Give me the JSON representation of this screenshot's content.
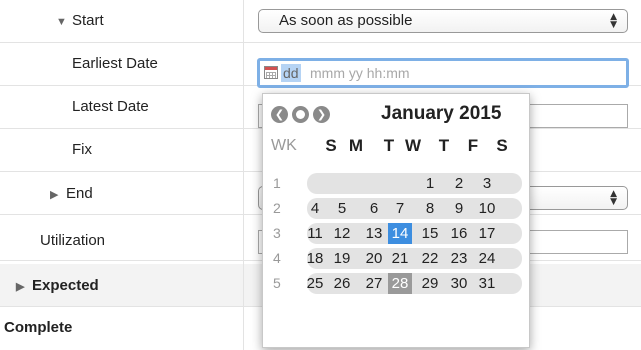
{
  "rows": {
    "start": {
      "label": "Start",
      "value": "As soon as possible"
    },
    "earliest_date": {
      "label": "Earliest Date",
      "placeholder_day": "dd",
      "placeholder_rest": "mmm yy hh:mm"
    },
    "latest_date": {
      "label": "Latest Date"
    },
    "fix": {
      "label": "Fix"
    },
    "end": {
      "label": "End"
    },
    "utilization": {
      "label": "Utilization"
    },
    "expected": {
      "label": "Expected"
    },
    "complete": {
      "label": "Complete"
    }
  },
  "icons": {
    "expanded": "triangle-down-icon",
    "collapsed": "triangle-right-icon",
    "calendar": "calendar-icon",
    "prev": "prev-month-icon",
    "today": "today-icon",
    "next": "next-month-icon"
  },
  "calendar": {
    "month_title": "January 2015",
    "week_header": "WK",
    "day_headers": [
      "S",
      "M",
      "T",
      "W",
      "T",
      "F",
      "S"
    ],
    "weeks": [
      {
        "wk": "1",
        "days": [
          "",
          "",
          "",
          "",
          "1",
          "2",
          "3"
        ]
      },
      {
        "wk": "2",
        "days": [
          "4",
          "5",
          "6",
          "7",
          "8",
          "9",
          "10"
        ]
      },
      {
        "wk": "3",
        "days": [
          "11",
          "12",
          "13",
          "14",
          "15",
          "16",
          "17"
        ]
      },
      {
        "wk": "4",
        "days": [
          "18",
          "19",
          "20",
          "21",
          "22",
          "23",
          "24"
        ]
      },
      {
        "wk": "5",
        "days": [
          "25",
          "26",
          "27",
          "28",
          "29",
          "30",
          "31"
        ]
      }
    ],
    "selected_day": "14",
    "today_day": "28",
    "colors": {
      "selected": "#3d8ee0",
      "today": "#9a9a9a",
      "focus_ring": "#7eb0e6"
    }
  }
}
